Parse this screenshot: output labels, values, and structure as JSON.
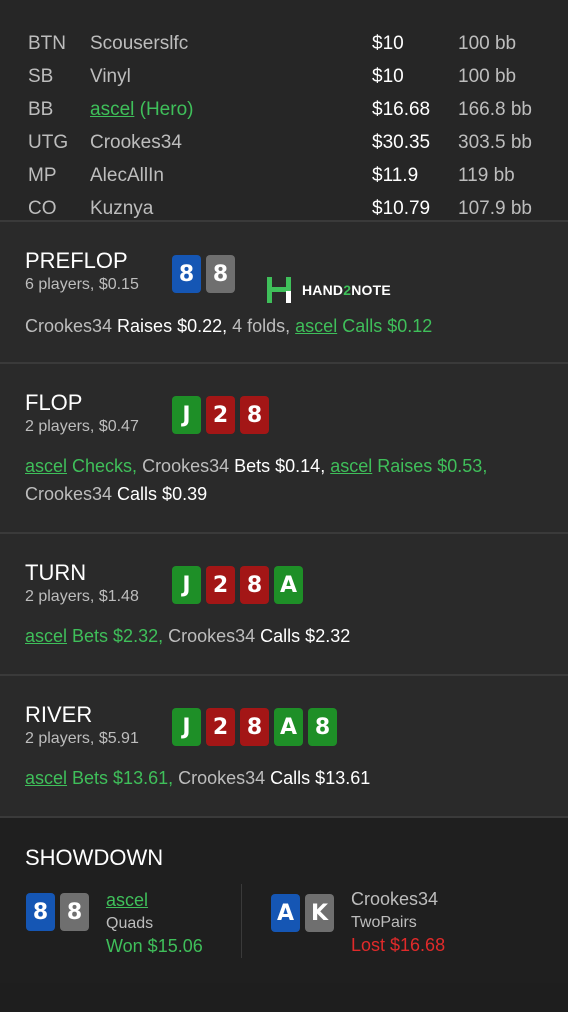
{
  "players": [
    {
      "pos": "BTN",
      "name": "Scouserslfc",
      "money": "$10",
      "bb": "100 bb"
    },
    {
      "pos": "SB",
      "name": "Vinyl",
      "money": "$10",
      "bb": "100 bb"
    },
    {
      "pos": "BB",
      "name": "ascel",
      "suffix": " (Hero)",
      "money": "$16.68",
      "bb": "166.8 bb",
      "hero": true
    },
    {
      "pos": "UTG",
      "name": "Crookes34",
      "money": "$30.35",
      "bb": "303.5 bb"
    },
    {
      "pos": "MP",
      "name": "AlecAllIn",
      "money": "$11.9",
      "bb": "119 bb"
    },
    {
      "pos": "CO",
      "name": "Kuznya",
      "money": "$10.79",
      "bb": "107.9 bb"
    }
  ],
  "logo": {
    "prefix": "HAND",
    "mid": "2",
    "suffix": "NOTE"
  },
  "streets": {
    "preflop": {
      "title": "PREFLOP",
      "sub": "6 players, $0.15",
      "cards": [
        {
          "rank": "8",
          "color": "blue"
        },
        {
          "rank": "8",
          "color": "gray"
        }
      ],
      "a1": "Crookes34",
      "a2": " Raises $0.22,",
      "a3": " 4 folds, ",
      "a4": "ascel",
      "a5": " Calls $0.12"
    },
    "flop": {
      "title": "FLOP",
      "sub": "2 players, $0.47",
      "cards": [
        {
          "rank": "J",
          "color": "green"
        },
        {
          "rank": "2",
          "color": "red"
        },
        {
          "rank": "8",
          "color": "red"
        }
      ],
      "a1": "ascel",
      "a2": " Checks,",
      "a3": " Crookes34",
      "a4": " Bets $0.14,",
      "a5": "ascel",
      "a6": " Raises $0.53,",
      "a7": "Crookes34",
      "a8": " Calls $0.39"
    },
    "turn": {
      "title": "TURN",
      "sub": "2 players, $1.48",
      "cards": [
        {
          "rank": "J",
          "color": "green"
        },
        {
          "rank": "2",
          "color": "red"
        },
        {
          "rank": "8",
          "color": "red"
        },
        {
          "rank": "A",
          "color": "green"
        }
      ],
      "a1": "ascel",
      "a2": " Bets $2.32,",
      "a3": " Crookes34",
      "a4": " Calls $2.32"
    },
    "river": {
      "title": "RIVER",
      "sub": "2 players, $5.91",
      "cards": [
        {
          "rank": "J",
          "color": "green"
        },
        {
          "rank": "2",
          "color": "red"
        },
        {
          "rank": "8",
          "color": "red"
        },
        {
          "rank": "A",
          "color": "green"
        },
        {
          "rank": "8",
          "color": "green"
        }
      ],
      "a1": "ascel",
      "a2": " Bets $13.61,",
      "a3": " Crookes34",
      "a4": " Calls $13.61"
    }
  },
  "showdown": {
    "title": "SHOWDOWN",
    "left": {
      "cards": [
        {
          "rank": "8",
          "color": "blue"
        },
        {
          "rank": "8",
          "color": "gray"
        }
      ],
      "name": "ascel",
      "hand": "Quads",
      "result": "Won $15.06"
    },
    "right": {
      "cards": [
        {
          "rank": "A",
          "color": "blue"
        },
        {
          "rank": "K",
          "color": "gray"
        }
      ],
      "name": "Crookes34",
      "hand": "TwoPairs",
      "result": "Lost $16.68"
    }
  },
  "colors": {
    "green": "#3fbf5a",
    "red": "#e02a2a",
    "card_blue": "#1556b4",
    "card_gray": "#6f6f6f",
    "card_green": "#1e8f27",
    "card_red": "#a31616"
  }
}
